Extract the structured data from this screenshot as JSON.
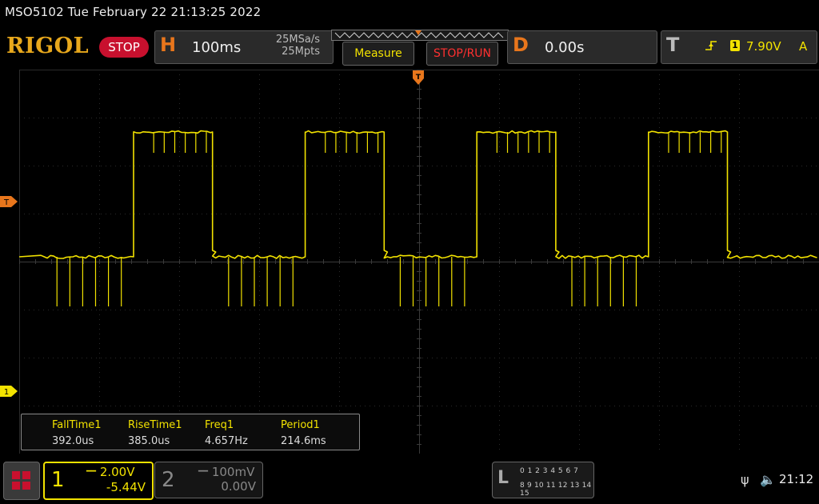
{
  "header": {
    "model_datetime": "MSO5102  Tue February 22 21:13:25 2022",
    "logo": "RIGOL",
    "run_state": "STOP"
  },
  "horizontal": {
    "letter": "H",
    "timebase": "100ms",
    "sample_rate": "25MSa/s",
    "memory_depth": "25Mpts"
  },
  "buttons": {
    "measure": "Measure",
    "stop_run": "STOP/RUN"
  },
  "delay": {
    "letter": "D",
    "value": "0.00s"
  },
  "trigger": {
    "letter": "T",
    "edge_icon": "rising-edge-icon",
    "source": "1",
    "level": "7.90V",
    "mode": "A"
  },
  "markers": {
    "trigger_level_label": "T",
    "ch1_ground_label": "1"
  },
  "measurements": [
    {
      "name": "FallTime1",
      "value": "392.0us"
    },
    {
      "name": "RiseTime1",
      "value": "385.0us"
    },
    {
      "name": "Freq1",
      "value": "4.657Hz"
    },
    {
      "name": "Period1",
      "value": "214.6ms"
    }
  ],
  "ch1": {
    "number": "1",
    "scale": "2.00V",
    "offset": "-5.44V",
    "coupling_icon": "dc-coupling-icon"
  },
  "ch2": {
    "number": "2",
    "scale": "100mV",
    "offset": "0.00V",
    "coupling_icon": "dc-coupling-icon"
  },
  "logic": {
    "letter": "L",
    "row1": "0 1 2 3  4 5 6 7",
    "row2": "8 9 10 11 12 13 14 15"
  },
  "status": {
    "usb_icon": "usb-icon",
    "speaker_icon": "speaker-muted-icon",
    "time": "21:12"
  },
  "colors": {
    "ch1": "#f2e200",
    "accent_orange": "#e8761c",
    "stop_red": "#c8102e",
    "logo": "#e8a81c"
  },
  "waveform": {
    "channel": "1",
    "shape": "square",
    "period_divs": 2.146,
    "high_level_divs_above_ch1_ground": 5.4,
    "low_level_divs_above_ch1_ground": 2.8,
    "first_rising_edge_div": 1.43,
    "duty_cycle": 0.46
  }
}
